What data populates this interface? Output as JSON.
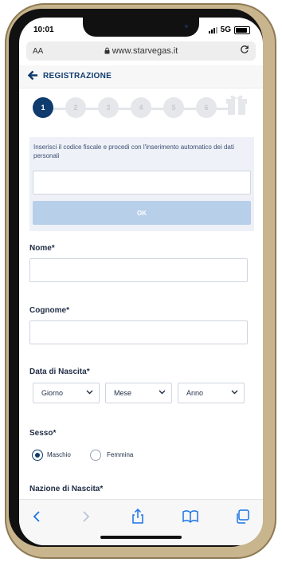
{
  "status": {
    "time": "10:01",
    "network": "5G"
  },
  "browser": {
    "aa_label": "AA",
    "url": "www.starvegas.it"
  },
  "header": {
    "title": "REGISTRAZIONE"
  },
  "steps": [
    {
      "label": "1",
      "active": true
    },
    {
      "label": "2",
      "active": false
    },
    {
      "label": "3",
      "active": false
    },
    {
      "label": "4",
      "active": false
    },
    {
      "label": "5",
      "active": false
    },
    {
      "label": "6",
      "active": false
    }
  ],
  "fiscal_code": {
    "instruction": "Inserisci il codice fiscale e procedi con l'inserimento automatico dei dati personali",
    "input_value": "",
    "ok_label": "OK"
  },
  "form": {
    "nome_label": "Nome*",
    "cognome_label": "Cognome*",
    "data_nascita_label": "Data di Nascita*",
    "giorno": "Giorno",
    "mese": "Mese",
    "anno": "Anno",
    "sesso_label": "Sesso*",
    "maschio": "Maschio",
    "femmina": "Femmina",
    "nazione_label": "Nazione di Nascita*"
  },
  "colors": {
    "primary": "#0f3b6e",
    "ok_button": "#b7cfe9",
    "box_bg": "#eef1f7",
    "ios_blue": "#1a73e8"
  },
  "icons": [
    "lock-icon",
    "reload-icon",
    "back-arrow-icon",
    "gift-icon",
    "chevron-down-icon",
    "share-icon",
    "bookmarks-icon",
    "tabs-icon"
  ]
}
